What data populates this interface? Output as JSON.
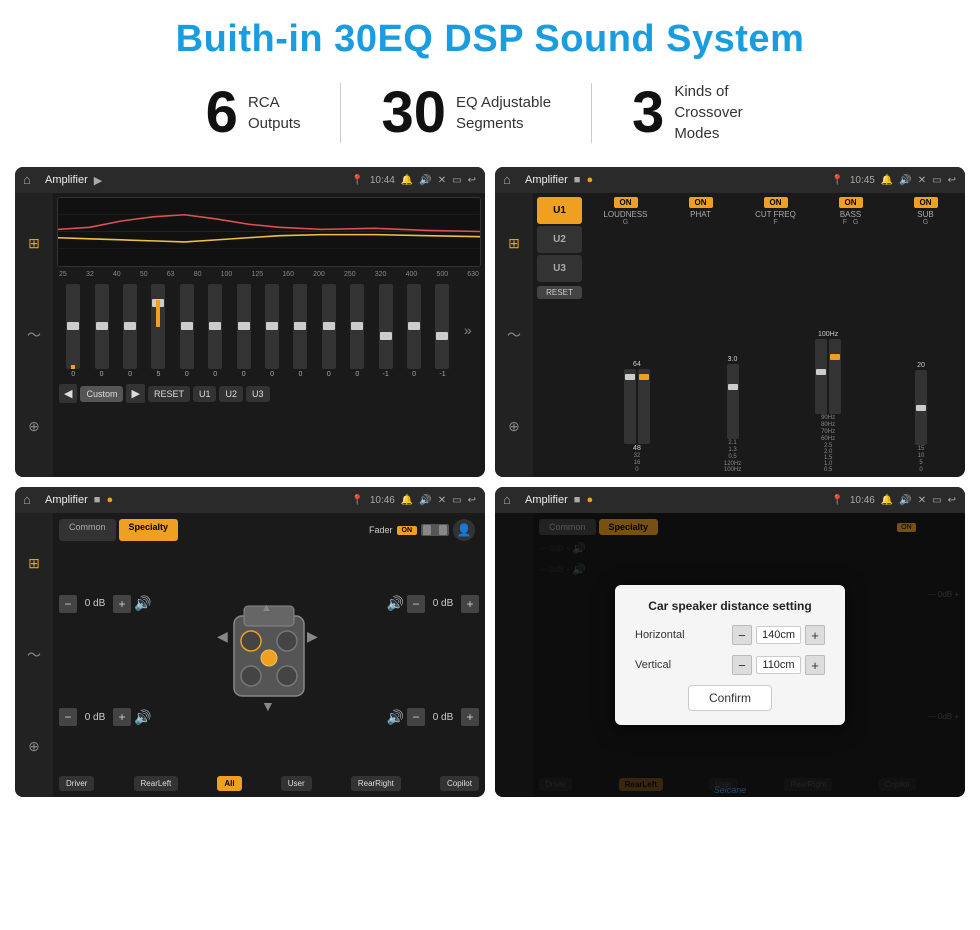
{
  "header": {
    "title": "Buith-in 30EQ DSP Sound System"
  },
  "stats": [
    {
      "number": "6",
      "label": "RCA\nOutputs"
    },
    {
      "number": "30",
      "label": "EQ Adjustable\nSegments"
    },
    {
      "number": "3",
      "label": "Kinds of\nCrossover Modes"
    }
  ],
  "screens": {
    "eq": {
      "title": "Amplifier",
      "time": "10:44",
      "frequencies": [
        "25",
        "32",
        "40",
        "50",
        "63",
        "80",
        "100",
        "125",
        "160",
        "200",
        "250",
        "320",
        "400",
        "500",
        "630"
      ],
      "sliders": [
        0,
        0,
        0,
        5,
        0,
        0,
        0,
        0,
        0,
        0,
        0,
        -1,
        0,
        -1
      ],
      "presets": [
        "Custom",
        "RESET",
        "U1",
        "U2",
        "U3"
      ]
    },
    "amplifier": {
      "title": "Amplifier",
      "time": "10:45",
      "channels": [
        "U1",
        "U2",
        "U3"
      ],
      "controls": [
        "LOUDNESS",
        "PHAT",
        "CUT FREQ",
        "BASS",
        "SUB"
      ]
    },
    "speaker": {
      "title": "Amplifier",
      "time": "10:46",
      "tabs": [
        "Common",
        "Specialty"
      ],
      "faderLabel": "Fader",
      "controls": {
        "topLeft": "0 dB",
        "bottomLeft": "0 dB",
        "topRight": "0 dB",
        "bottomRight": "0 dB"
      },
      "buttons": [
        "Driver",
        "RearLeft",
        "All",
        "User",
        "RearRight",
        "Copilot"
      ]
    },
    "dialog": {
      "title": "Amplifier",
      "time": "10:46",
      "dialogTitle": "Car speaker distance setting",
      "horizontal": {
        "label": "Horizontal",
        "value": "140cm"
      },
      "vertical": {
        "label": "Vertical",
        "value": "110cm"
      },
      "confirmLabel": "Confirm",
      "rightControls": {
        "top": "0 dB",
        "bottom": "0 dB"
      },
      "buttons": [
        "Driver",
        "RearLeft",
        "User",
        "RearRight",
        "Copilot"
      ]
    }
  },
  "watermark": "Seicane"
}
